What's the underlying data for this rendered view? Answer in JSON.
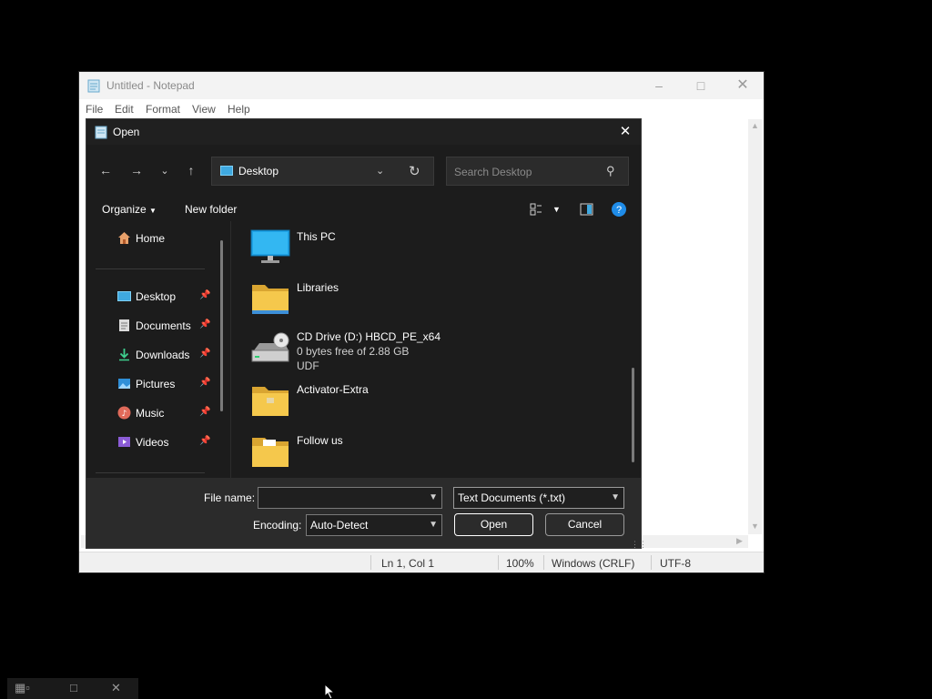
{
  "notepad": {
    "title": "Untitled - Notepad",
    "menu": [
      "File",
      "Edit",
      "Format",
      "View",
      "Help"
    ],
    "status": {
      "position": "Ln 1, Col 1",
      "zoom": "100%",
      "line_ending": "Windows (CRLF)",
      "encoding": "UTF-8"
    }
  },
  "dialog": {
    "title": "Open",
    "address": "Desktop",
    "search_placeholder": "Search Desktop",
    "toolbar": {
      "organize": "Organize",
      "new_folder": "New folder"
    },
    "nav": {
      "home": "Home",
      "items": [
        {
          "label": "Desktop",
          "icon": "desktop-icon"
        },
        {
          "label": "Documents",
          "icon": "documents-icon"
        },
        {
          "label": "Downloads",
          "icon": "downloads-icon"
        },
        {
          "label": "Pictures",
          "icon": "pictures-icon"
        },
        {
          "label": "Music",
          "icon": "music-icon"
        },
        {
          "label": "Videos",
          "icon": "videos-icon"
        }
      ]
    },
    "files": [
      {
        "name": "This PC",
        "icon": "computer-icon"
      },
      {
        "name": "Libraries",
        "icon": "folder-icon"
      },
      {
        "name": "CD Drive (D:) HBCD_PE_x64",
        "sub1": "0 bytes free of 2.88 GB",
        "sub2": "UDF",
        "icon": "cd-drive-icon"
      },
      {
        "name": "Activator-Extra",
        "icon": "folder-icon"
      },
      {
        "name": "Follow us",
        "icon": "folder-icon"
      }
    ],
    "file_name_label": "File name:",
    "file_name_value": "",
    "file_type": "Text Documents (*.txt)",
    "encoding_label": "Encoding:",
    "encoding_value": "Auto-Detect",
    "open_button": "Open",
    "cancel_button": "Cancel"
  },
  "colors": {
    "dialog_bg": "#1c1c1c",
    "accent": "#3fa9e0",
    "help_blue": "#1f8ce8"
  }
}
